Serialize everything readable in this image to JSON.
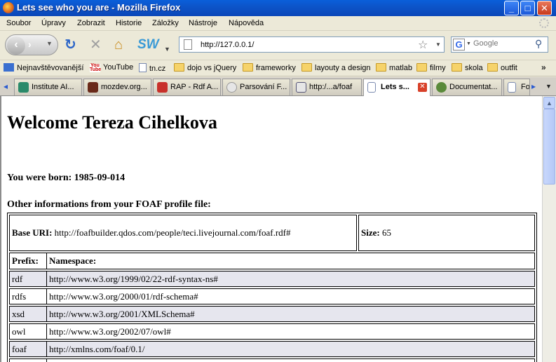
{
  "window": {
    "title": "Lets see who you are - Mozilla Firefox",
    "min": "_",
    "max": "□",
    "close": "✕"
  },
  "menu": [
    "Soubor",
    "Úpravy",
    "Zobrazit",
    "Historie",
    "Záložky",
    "Nástroje",
    "Nápověda"
  ],
  "nav": {
    "url": "http://127.0.0.1/",
    "search_placeholder": "Google",
    "sw_label": "SW"
  },
  "bookmarks": [
    {
      "label": "Nejnavštěvovanější",
      "icon": "bookmarks-star-icon"
    },
    {
      "label": "YouTube",
      "icon": "youtube-icon"
    },
    {
      "label": "tn.cz",
      "icon": "page-icon"
    },
    {
      "label": "dojo vs jQuery",
      "icon": "folder-icon"
    },
    {
      "label": "frameworky",
      "icon": "folder-icon"
    },
    {
      "label": "layouty a design",
      "icon": "folder-icon"
    },
    {
      "label": "matlab",
      "icon": "folder-icon"
    },
    {
      "label": "filmy",
      "icon": "folder-icon"
    },
    {
      "label": "skola",
      "icon": "folder-icon"
    },
    {
      "label": "outfit",
      "icon": "folder-icon"
    }
  ],
  "tabs": [
    {
      "label": "Institute AI...",
      "active": false
    },
    {
      "label": "mozdev.org...",
      "active": false
    },
    {
      "label": "RAP - Rdf A...",
      "active": false
    },
    {
      "label": "Parsování F...",
      "active": false
    },
    {
      "label": "http:/...a/foaf",
      "active": false
    },
    {
      "label": "Lets s...",
      "active": true
    },
    {
      "label": "Documentat...",
      "active": false
    },
    {
      "label": "Fo",
      "active": false
    }
  ],
  "content": {
    "welcome": "Welcome Tereza Cihelkova",
    "born": "You were born: 1985-09-014",
    "other_info": "Other informations from your FOAF profile file:",
    "base_uri_label": "Base URI:",
    "base_uri": "http://foafbuilder.qdos.com/people/teci.livejournal.com/foaf.rdf#",
    "size_label": "Size:",
    "size": "65",
    "prefix_header": "Prefix:",
    "namespace_header": "Namespace:",
    "namespaces": [
      {
        "prefix": "rdf",
        "ns": "http://www.w3.org/1999/02/22-rdf-syntax-ns#"
      },
      {
        "prefix": "rdfs",
        "ns": "http://www.w3.org/2000/01/rdf-schema#"
      },
      {
        "prefix": "xsd",
        "ns": "http://www.w3.org/2001/XMLSchema#"
      },
      {
        "prefix": "owl",
        "ns": "http://www.w3.org/2002/07/owl#"
      },
      {
        "prefix": "foaf",
        "ns": "http://xmlns.com/foaf/0.1/"
      }
    ]
  }
}
